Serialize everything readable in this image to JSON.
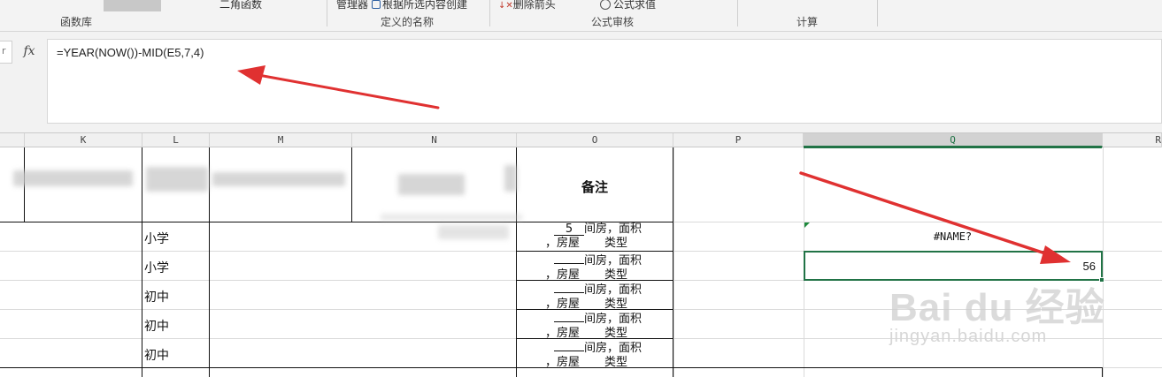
{
  "ribbon": {
    "top_fragments": [
      "二角函数",
      "管理器",
      "根据所选内容创建",
      "删除箭头",
      "公式求值"
    ],
    "groups": [
      "函数库",
      "定义的名称",
      "公式审核",
      "计算"
    ]
  },
  "formula_bar": {
    "name_box_fragment": "r",
    "fx_label": "fx",
    "formula": "=YEAR(NOW())-MID(E5,7,4)"
  },
  "columns": [
    "K",
    "L",
    "M",
    "N",
    "O",
    "P",
    "Q",
    "R"
  ],
  "active_column": "Q",
  "header_remark": "备注",
  "rows": [
    {
      "L": "小学",
      "O_num": "5"
    },
    {
      "L": "小学",
      "O_num": ""
    },
    {
      "L": "初中",
      "O_num": ""
    },
    {
      "L": "初中",
      "O_num": ""
    },
    {
      "L": "初中",
      "O_num": ""
    }
  ],
  "remark_text": {
    "rooms_suffix": "间房，面积",
    "house_prefix": "，房屋",
    "type_suffix": "类型"
  },
  "q_error": "#NAME?",
  "q_active_value": "56",
  "watermark": {
    "logo": "Bai  du 经验",
    "url": "jingyan.baidu.com"
  },
  "colors": {
    "selection_green": "#217346",
    "arrow_red": "#e03131"
  }
}
